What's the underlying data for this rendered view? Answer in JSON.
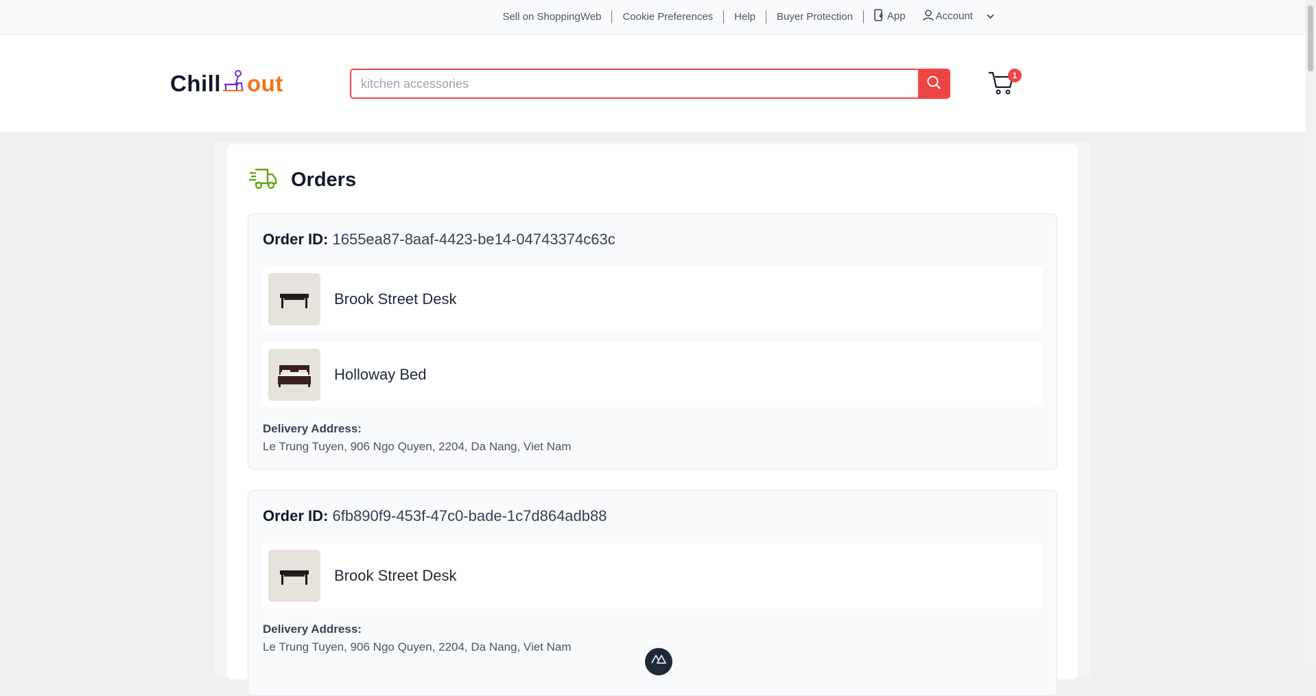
{
  "topbar": {
    "links": [
      "Sell on ShoppingWeb",
      "Cookie Preferences",
      "Help",
      "Buyer Protection"
    ],
    "app_label": "App",
    "account_label": "Account"
  },
  "header": {
    "logo_left": "Chill",
    "logo_right": "out",
    "search": {
      "placeholder": "kitchen accessories",
      "value": ""
    },
    "cart_count": "1"
  },
  "main": {
    "title": "Orders",
    "orders": [
      {
        "id_label": "Order ID:",
        "id": "1655ea87-8aaf-4423-be14-04743374c63c",
        "items": [
          "Brook Street Desk",
          "Holloway Bed"
        ],
        "address_label": "Delivery Address:",
        "address": "Le Trung Tuyen, 906 Ngo Quyen, 2204, Da Nang, Viet Nam"
      },
      {
        "id_label": "Order ID:",
        "id": "6fb890f9-453f-47c0-bade-1c7d864adb88",
        "items": [
          "Brook Street Desk"
        ],
        "address_label": "Delivery Address:",
        "address": "Le Trung Tuyen, 906 Ngo Quyen, 2204, Da Nang, Viet Nam"
      }
    ]
  },
  "colors": {
    "accent": "#ef4444",
    "brand_orange": "#f97316",
    "truck_green": "#65a30d"
  },
  "icons": [
    "download-app-icon",
    "user-icon",
    "chevron-down-icon",
    "search-icon",
    "cart-icon",
    "truck-icon",
    "desk-image",
    "bed-image",
    "nuxt-devtools-icon"
  ]
}
